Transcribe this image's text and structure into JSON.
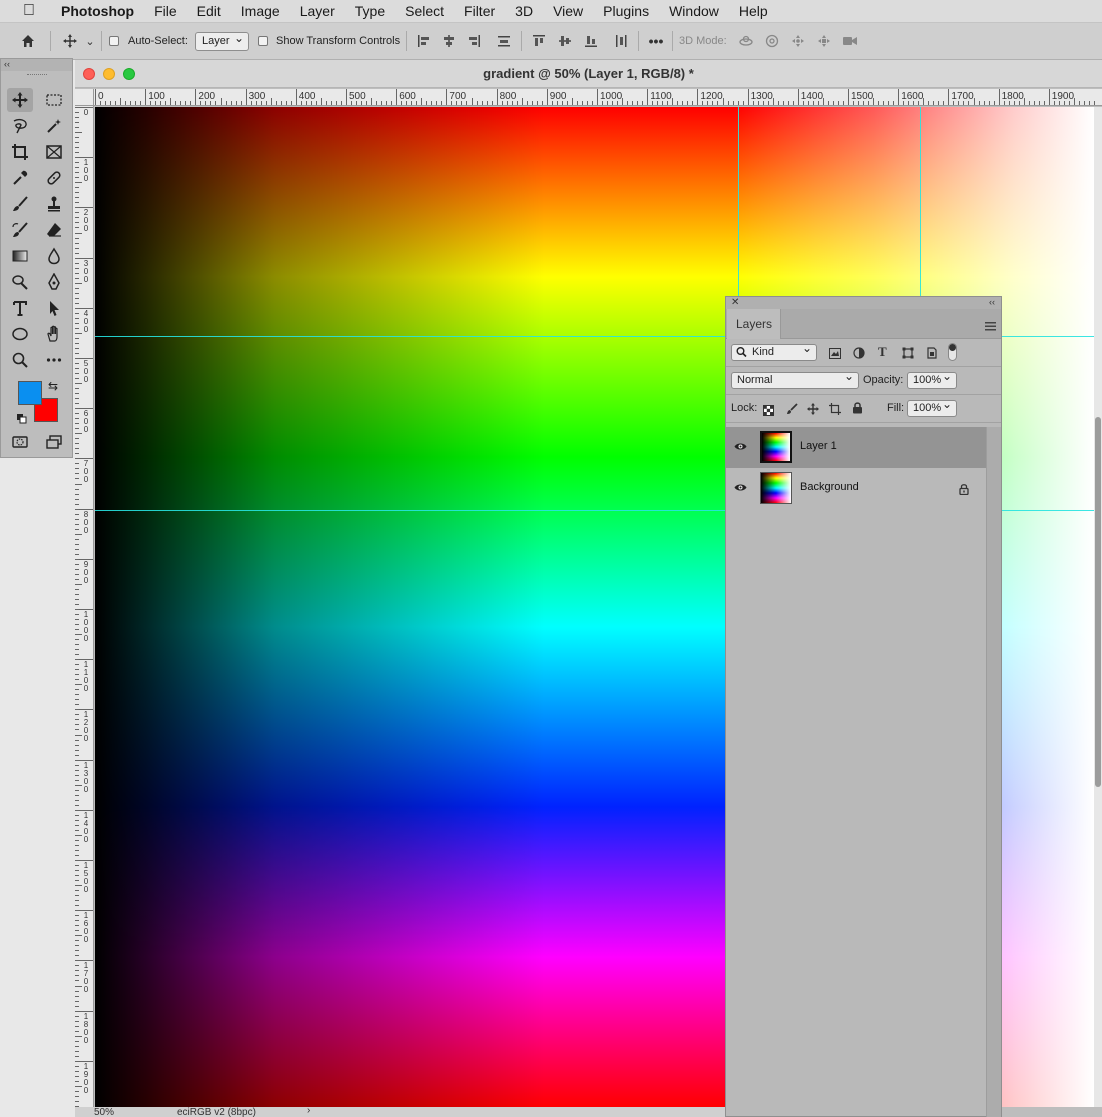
{
  "menubar": {
    "app": "Photoshop",
    "items": [
      "File",
      "Edit",
      "Image",
      "Layer",
      "Type",
      "Select",
      "Filter",
      "3D",
      "View",
      "Plugins",
      "Window",
      "Help"
    ]
  },
  "options": {
    "auto_select_label": "Auto-Select:",
    "auto_select_value": "Layer",
    "show_transform_label": "Show Transform Controls",
    "mode_3d_label": "3D Mode:"
  },
  "document": {
    "title": "gradient @ 50% (Layer 1, RGB/8) *",
    "ruler_h_labels": [
      "0",
      "100",
      "200",
      "300",
      "400",
      "500",
      "600",
      "700",
      "800",
      "900",
      "1000",
      "1100",
      "1200",
      "1300",
      "1400",
      "1500",
      "1600",
      "1700",
      "1800",
      "1900"
    ],
    "ruler_v_labels": [
      "0",
      "100",
      "200",
      "300",
      "400",
      "500",
      "600",
      "700",
      "800",
      "900",
      "1000",
      "1100",
      "1200",
      "1300",
      "1400",
      "1500",
      "1600",
      "1700",
      "1800",
      "1900"
    ],
    "zoom": "50%",
    "profile": "eciRGB v2 (8bpc)"
  },
  "colors": {
    "foreground": "#0a8ff0",
    "background": "#ff0000",
    "guide": "#27e3e0"
  },
  "layers_panel": {
    "tab": "Layers",
    "filter_kind": "Kind",
    "blend_mode": "Normal",
    "opacity_label": "Opacity:",
    "opacity": "100%",
    "lock_label": "Lock:",
    "fill_label": "Fill:",
    "fill": "100%",
    "layers": [
      {
        "name": "Layer 1",
        "selected": true,
        "locked": false
      },
      {
        "name": "Background",
        "selected": false,
        "locked": true
      }
    ]
  }
}
